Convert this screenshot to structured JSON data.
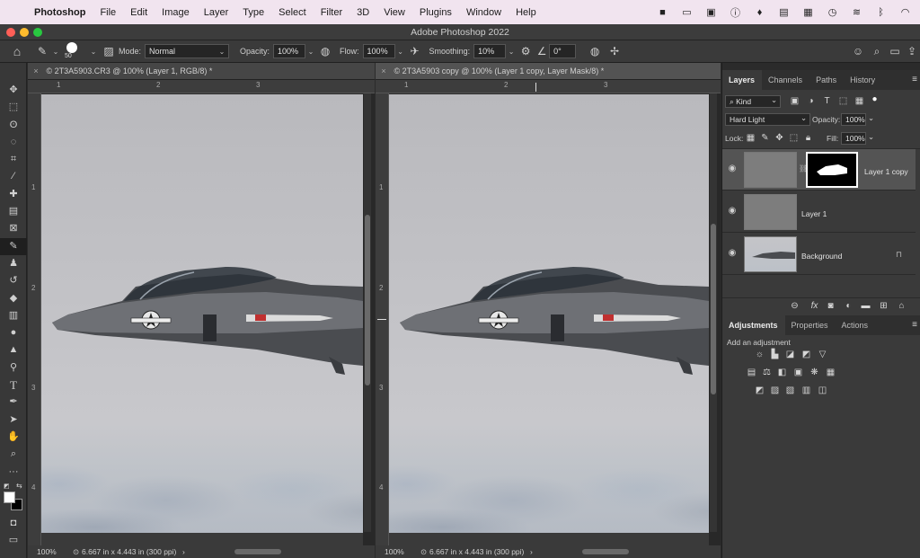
{
  "menubar": {
    "app": "Photoshop",
    "items": [
      "File",
      "Edit",
      "Image",
      "Layer",
      "Type",
      "Select",
      "Filter",
      "3D",
      "View",
      "Plugins",
      "Window",
      "Help"
    ]
  },
  "window": {
    "title": "Adobe Photoshop 2022"
  },
  "options": {
    "brush_size": "50",
    "mode_label": "Mode:",
    "mode_value": "Normal",
    "opacity_label": "Opacity:",
    "opacity_value": "100%",
    "flow_label": "Flow:",
    "flow_value": "100%",
    "smoothing_label": "Smoothing:",
    "smoothing_value": "10%",
    "angle_value": "0°"
  },
  "documents": [
    {
      "tab": "2T3A5903.CR3 @ 100% (Layer 1, RGB/8) *",
      "zoom": "100%",
      "info": "6.667 in x 4.443 in (300 ppi)"
    },
    {
      "tab": "2T3A5903 copy @ 100% (Layer 1 copy, Layer Mask/8) *",
      "zoom": "100%",
      "info": "6.667 in x 4.443 in (300 ppi)"
    }
  ],
  "rulers": {
    "h": [
      "1",
      "2",
      "3"
    ],
    "v": [
      "1",
      "2",
      "3",
      "4"
    ]
  },
  "layers_panel": {
    "tabs": [
      "Layers",
      "Channels",
      "Paths",
      "History"
    ],
    "filter": "Kind",
    "blend_mode": "Hard Light",
    "opacity_label": "Opacity:",
    "opacity_value": "100%",
    "lock_label": "Lock:",
    "fill_label": "Fill:",
    "fill_value": "100%",
    "layers": [
      {
        "name": "Layer 1 copy"
      },
      {
        "name": "Layer 1"
      },
      {
        "name": "Background"
      }
    ]
  },
  "adjustments_panel": {
    "tabs": [
      "Adjustments",
      "Properties",
      "Actions"
    ],
    "hint": "Add an adjustment"
  },
  "colors": {
    "menubar_bg": "#f1e4ef",
    "app_bg": "#2b2b2b",
    "panel_bg": "#3a3a3a",
    "selected_layer": "#545454"
  }
}
